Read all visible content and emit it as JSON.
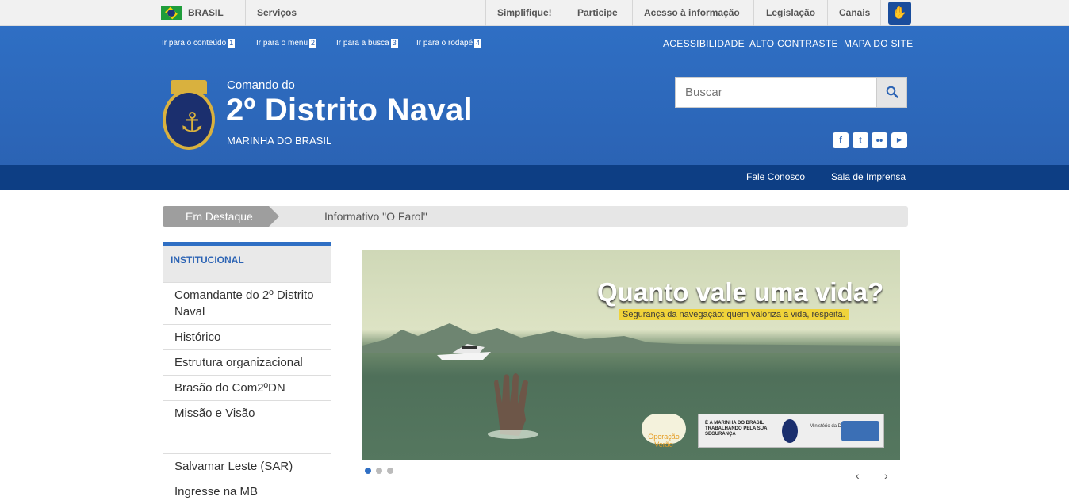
{
  "gov_bar": {
    "country": "BRASIL",
    "services": "Serviços",
    "links": [
      "Simplifique!",
      "Participe",
      "Acesso à informação",
      "Legislação",
      "Canais"
    ],
    "badge_icon": "accessibility-hand-icon"
  },
  "header": {
    "skip_links": [
      {
        "label": "Ir para o conteúdo",
        "key": "1"
      },
      {
        "label": "Ir para o menu",
        "key": "2"
      },
      {
        "label": "Ir para a busca",
        "key": "3"
      },
      {
        "label": "Ir para o rodapé",
        "key": "4"
      }
    ],
    "top_links": [
      "ACESSIBILIDADE",
      "ALTO CONTRASTE",
      "MAPA DO SITE"
    ],
    "pre_title": "Comando do",
    "title": "2º Distrito Naval",
    "subtitle": "MARINHA DO BRASIL",
    "logo_text": "MARINHA DO BRASIL",
    "search_placeholder": "Buscar",
    "social": [
      "facebook",
      "twitter",
      "flickr",
      "youtube"
    ]
  },
  "subbar": {
    "links": [
      "Fale Conosco",
      "Sala de Imprensa"
    ]
  },
  "highlight": {
    "tag": "Em Destaque",
    "text": "Informativo \"O Farol\""
  },
  "menu": {
    "heading": "INSTITUCIONAL",
    "items": [
      "Comandante do 2º Distrito Naval",
      "Histórico",
      "Estrutura organizacional",
      "Brasão do Com2ºDN",
      "Missão e Visão",
      "Salvamar Leste (SAR)",
      "Ingresse na MB"
    ]
  },
  "slide": {
    "headline": "Quanto vale uma vida?",
    "subline": "Segurança da navegação: quem valoriza a vida, respeita.",
    "operation": "Operação Verão",
    "footer_text": "É A MARINHA DO BRASIL TRABALHANDO PELA SUA SEGURANÇA",
    "ministry": "Ministério da Defesa",
    "dot_count": 3,
    "active_dot": 0
  },
  "colors": {
    "header_blue": "#2f6fc4",
    "dark_blue": "#0d3e84",
    "accent_yellow": "#f0d33a"
  }
}
